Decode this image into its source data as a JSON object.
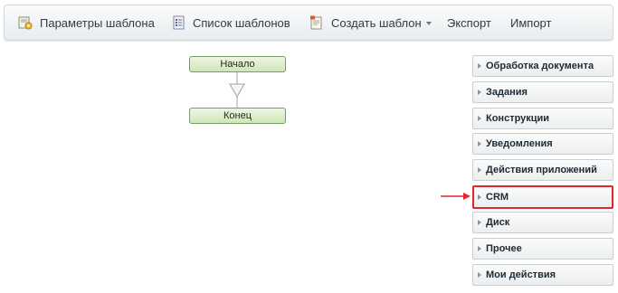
{
  "toolbar": {
    "items": [
      {
        "label": "Параметры шаблона",
        "icon": "template-settings-icon"
      },
      {
        "label": "Список шаблонов",
        "icon": "template-list-icon"
      },
      {
        "label": "Создать шаблон",
        "icon": "create-template-icon"
      },
      {
        "label": "Экспорт"
      },
      {
        "label": "Импорт"
      }
    ]
  },
  "diagram": {
    "start_label": "Начало",
    "end_label": "Конец"
  },
  "panel": {
    "items": [
      {
        "label": "Обработка документа"
      },
      {
        "label": "Задания"
      },
      {
        "label": "Конструкции"
      },
      {
        "label": "Уведомления"
      },
      {
        "label": "Действия приложений"
      },
      {
        "label": "CRM",
        "highlighted": true
      },
      {
        "label": "Диск"
      },
      {
        "label": "Прочее"
      },
      {
        "label": "Мои действия"
      }
    ]
  },
  "colors": {
    "highlight": "#e3262a",
    "node_fill": "#cfe6b8",
    "node_border": "#7a9a67"
  }
}
